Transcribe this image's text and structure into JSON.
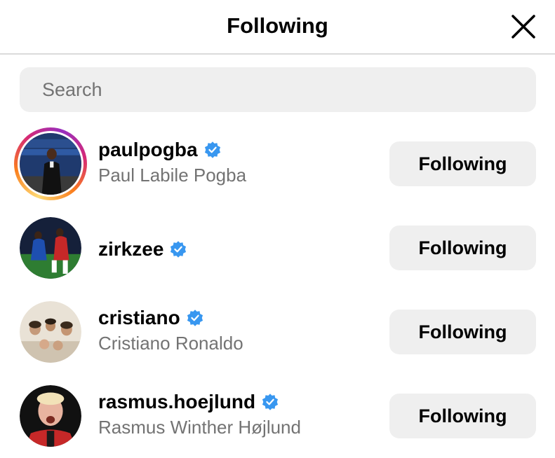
{
  "header": {
    "title": "Following",
    "close_icon": "close-icon"
  },
  "search": {
    "placeholder": "Search",
    "value": ""
  },
  "accounts": [
    {
      "username": "paulpogba",
      "full_name": "Paul Labile Pogba",
      "verified": true,
      "has_story": true,
      "button_label": "Following"
    },
    {
      "username": "zirkzee",
      "full_name": "",
      "verified": true,
      "has_story": false,
      "button_label": "Following"
    },
    {
      "username": "cristiano",
      "full_name": "Cristiano Ronaldo",
      "verified": true,
      "has_story": false,
      "button_label": "Following"
    },
    {
      "username": "rasmus.hoejlund",
      "full_name": "Rasmus Winther Højlund",
      "verified": true,
      "has_story": false,
      "button_label": "Following"
    }
  ],
  "colors": {
    "verified_blue": "#3897f0",
    "secondary_text": "#737373",
    "button_bg": "#efefef",
    "divider": "#dbdbdb"
  }
}
